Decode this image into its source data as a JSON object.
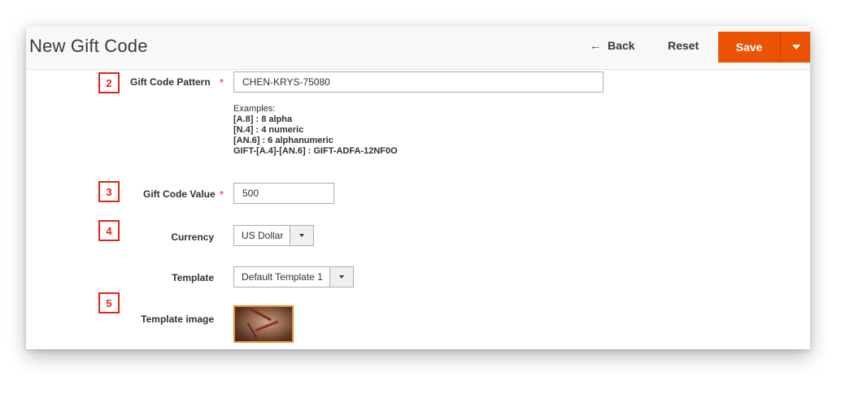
{
  "header": {
    "title": "New Gift Code",
    "back_arrow": "←",
    "back_label": "Back",
    "reset_label": "Reset",
    "save_label": "Save"
  },
  "callouts": [
    "2",
    "3",
    "4",
    "5"
  ],
  "required_marker": "*",
  "form": {
    "pattern": {
      "label": "Gift Code Pattern",
      "value": "CHEN-KRYS-75080",
      "examples_title": "Examples:",
      "examples": [
        "[A.8] : 8 alpha",
        "[N.4] : 4 numeric",
        "[AN.6] : 6 alphanumeric",
        "GIFT-[A.4]-[AN.6] : GIFT-ADFA-12NF0O"
      ]
    },
    "value": {
      "label": "Gift Code Value",
      "value": "500"
    },
    "currency": {
      "label": "Currency",
      "selected": "US Dollar"
    },
    "template": {
      "label": "Template",
      "selected": "Default Template 1"
    },
    "template_image": {
      "label": "Template image"
    }
  },
  "colors": {
    "accent": "#eb5202",
    "callout_border": "#e0251b",
    "required": "#e22626",
    "thumb_border": "#eb8a2f"
  },
  "icons": {
    "back": "arrow-left-icon",
    "save_toggle": "caret-down-icon",
    "select_toggle": "caret-down-icon"
  }
}
